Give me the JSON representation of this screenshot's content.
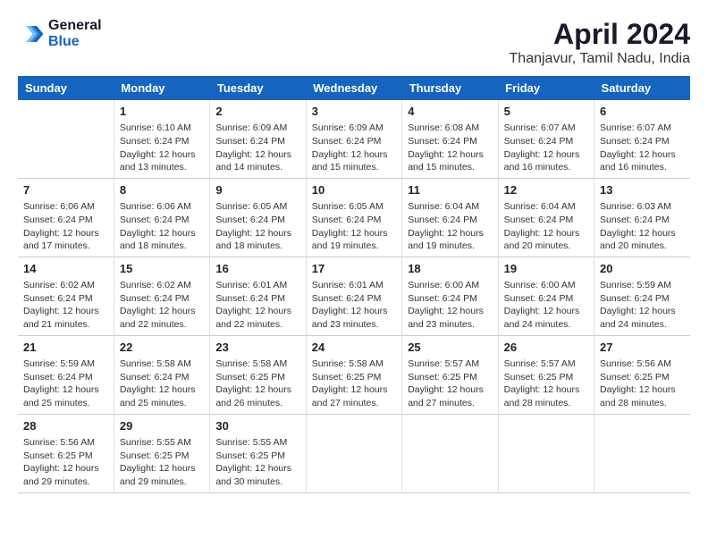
{
  "header": {
    "logo_line1": "General",
    "logo_line2": "Blue",
    "main_title": "April 2024",
    "subtitle": "Thanjavur, Tamil Nadu, India"
  },
  "calendar": {
    "days_of_week": [
      "Sunday",
      "Monday",
      "Tuesday",
      "Wednesday",
      "Thursday",
      "Friday",
      "Saturday"
    ],
    "weeks": [
      [
        {
          "day": "",
          "info": ""
        },
        {
          "day": "1",
          "info": "Sunrise: 6:10 AM\nSunset: 6:24 PM\nDaylight: 12 hours\nand 13 minutes."
        },
        {
          "day": "2",
          "info": "Sunrise: 6:09 AM\nSunset: 6:24 PM\nDaylight: 12 hours\nand 14 minutes."
        },
        {
          "day": "3",
          "info": "Sunrise: 6:09 AM\nSunset: 6:24 PM\nDaylight: 12 hours\nand 15 minutes."
        },
        {
          "day": "4",
          "info": "Sunrise: 6:08 AM\nSunset: 6:24 PM\nDaylight: 12 hours\nand 15 minutes."
        },
        {
          "day": "5",
          "info": "Sunrise: 6:07 AM\nSunset: 6:24 PM\nDaylight: 12 hours\nand 16 minutes."
        },
        {
          "day": "6",
          "info": "Sunrise: 6:07 AM\nSunset: 6:24 PM\nDaylight: 12 hours\nand 16 minutes."
        }
      ],
      [
        {
          "day": "7",
          "info": "Sunrise: 6:06 AM\nSunset: 6:24 PM\nDaylight: 12 hours\nand 17 minutes."
        },
        {
          "day": "8",
          "info": "Sunrise: 6:06 AM\nSunset: 6:24 PM\nDaylight: 12 hours\nand 18 minutes."
        },
        {
          "day": "9",
          "info": "Sunrise: 6:05 AM\nSunset: 6:24 PM\nDaylight: 12 hours\nand 18 minutes."
        },
        {
          "day": "10",
          "info": "Sunrise: 6:05 AM\nSunset: 6:24 PM\nDaylight: 12 hours\nand 19 minutes."
        },
        {
          "day": "11",
          "info": "Sunrise: 6:04 AM\nSunset: 6:24 PM\nDaylight: 12 hours\nand 19 minutes."
        },
        {
          "day": "12",
          "info": "Sunrise: 6:04 AM\nSunset: 6:24 PM\nDaylight: 12 hours\nand 20 minutes."
        },
        {
          "day": "13",
          "info": "Sunrise: 6:03 AM\nSunset: 6:24 PM\nDaylight: 12 hours\nand 20 minutes."
        }
      ],
      [
        {
          "day": "14",
          "info": "Sunrise: 6:02 AM\nSunset: 6:24 PM\nDaylight: 12 hours\nand 21 minutes."
        },
        {
          "day": "15",
          "info": "Sunrise: 6:02 AM\nSunset: 6:24 PM\nDaylight: 12 hours\nand 22 minutes."
        },
        {
          "day": "16",
          "info": "Sunrise: 6:01 AM\nSunset: 6:24 PM\nDaylight: 12 hours\nand 22 minutes."
        },
        {
          "day": "17",
          "info": "Sunrise: 6:01 AM\nSunset: 6:24 PM\nDaylight: 12 hours\nand 23 minutes."
        },
        {
          "day": "18",
          "info": "Sunrise: 6:00 AM\nSunset: 6:24 PM\nDaylight: 12 hours\nand 23 minutes."
        },
        {
          "day": "19",
          "info": "Sunrise: 6:00 AM\nSunset: 6:24 PM\nDaylight: 12 hours\nand 24 minutes."
        },
        {
          "day": "20",
          "info": "Sunrise: 5:59 AM\nSunset: 6:24 PM\nDaylight: 12 hours\nand 24 minutes."
        }
      ],
      [
        {
          "day": "21",
          "info": "Sunrise: 5:59 AM\nSunset: 6:24 PM\nDaylight: 12 hours\nand 25 minutes."
        },
        {
          "day": "22",
          "info": "Sunrise: 5:58 AM\nSunset: 6:24 PM\nDaylight: 12 hours\nand 25 minutes."
        },
        {
          "day": "23",
          "info": "Sunrise: 5:58 AM\nSunset: 6:25 PM\nDaylight: 12 hours\nand 26 minutes."
        },
        {
          "day": "24",
          "info": "Sunrise: 5:58 AM\nSunset: 6:25 PM\nDaylight: 12 hours\nand 27 minutes."
        },
        {
          "day": "25",
          "info": "Sunrise: 5:57 AM\nSunset: 6:25 PM\nDaylight: 12 hours\nand 27 minutes."
        },
        {
          "day": "26",
          "info": "Sunrise: 5:57 AM\nSunset: 6:25 PM\nDaylight: 12 hours\nand 28 minutes."
        },
        {
          "day": "27",
          "info": "Sunrise: 5:56 AM\nSunset: 6:25 PM\nDaylight: 12 hours\nand 28 minutes."
        }
      ],
      [
        {
          "day": "28",
          "info": "Sunrise: 5:56 AM\nSunset: 6:25 PM\nDaylight: 12 hours\nand 29 minutes."
        },
        {
          "day": "29",
          "info": "Sunrise: 5:55 AM\nSunset: 6:25 PM\nDaylight: 12 hours\nand 29 minutes."
        },
        {
          "day": "30",
          "info": "Sunrise: 5:55 AM\nSunset: 6:25 PM\nDaylight: 12 hours\nand 30 minutes."
        },
        {
          "day": "",
          "info": ""
        },
        {
          "day": "",
          "info": ""
        },
        {
          "day": "",
          "info": ""
        },
        {
          "day": "",
          "info": ""
        }
      ]
    ]
  }
}
